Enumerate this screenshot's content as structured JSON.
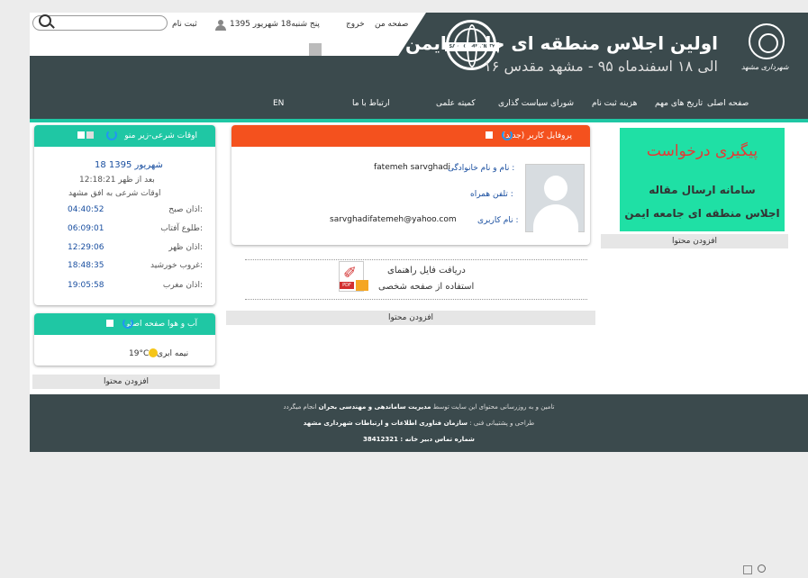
{
  "header": {
    "site_title": "اولین اجلاس منطقه ای جامعه ایمن",
    "site_subtitle": "۱۶ الی ۱۸ اسفندماه ۹۵ - مشهد مقدس",
    "logo_text": "SAFE COMMUNITY",
    "emblem_text": "شهرداری مشهد",
    "top_links": {
      "home": "صفحه من",
      "logout": "خروج",
      "date": "پنج شنبه18 شهریور 1395",
      "register": "ثبت نام"
    },
    "search_placeholder": ""
  },
  "nav": [
    "صفحه اصلی",
    "تاریخ های مهم",
    "هزینه ثبت نام",
    "شورای سیاست گذاری",
    "کمیته علمی",
    "ارتباط با ما",
    "EN"
  ],
  "promo": {
    "line1": "پیگیری درخواست",
    "line2": "سامانه ارسال مقاله",
    "line3": "اجلاس منطقه ای جامعه ایمن",
    "add_content": "افزودن محتوا"
  },
  "profile": {
    "header": "پروفایل کاربر (جدید)",
    "name_label": "نام و نام خانوادگی :",
    "name_value": "fatemeh sarvghadi",
    "phone_label": "تلفن همراه :",
    "phone_value": "",
    "username_label": "نام کاربری :",
    "username_value": "sarvghadifatemeh@yahoo.com",
    "download_line1": "دریافت فایل راهنمای",
    "download_line2": "استفاده از صفحه شخصی",
    "pdf_tag": "PDF",
    "add_content": "افزودن محتوا"
  },
  "prayer": {
    "header": "اوقات شرعی-زیر منو",
    "date": "18 شهریور 1395",
    "time": "12:18:21 بعد از ظهر",
    "title": "اوقات شرعی به افق مشهد",
    "rows": [
      {
        "name": "اذان صبح:",
        "value": "04:40:52"
      },
      {
        "name": "طلوع آفتاب:",
        "value": "06:09:01"
      },
      {
        "name": "اذان ظهر:",
        "value": "12:29:06"
      },
      {
        "name": "غروب خورشید:",
        "value": "18:48:35"
      },
      {
        "name": "اذان مغرب:",
        "value": "19:05:58"
      }
    ]
  },
  "weather": {
    "header": "آب و هوا صفحه اصلی",
    "temp": "19°C",
    "condition": "نیمه ابری",
    "add_content": "افزودن محتوا"
  },
  "footer": {
    "line1_pre": "تامین و به روزرسانی محتوای این سایت توسط",
    "line1_bold": "مدیریت ساماندهی و مهندسی بحران",
    "line1_post": "انجام میگردد",
    "line2_pre": "طراحی و پشتیبانی فنی :",
    "line2_bold": "سازمان فناوری اطلاعات و ارتباطات شهرداری مشهد",
    "line3": "شماره تماس دبیر خانه : 38412321"
  },
  "colors": {
    "header_bg": "#3b4a4d",
    "accent_green": "#1fc7a4",
    "profile_header": "#f4511e",
    "promo_bg": "#1fe0a5"
  }
}
